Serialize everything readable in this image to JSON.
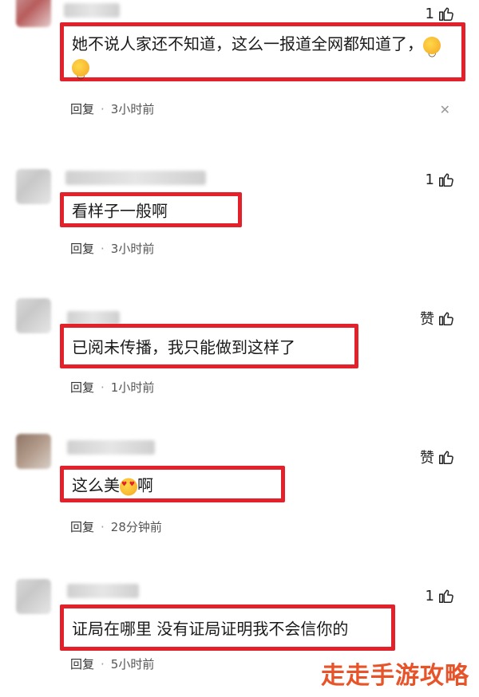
{
  "comments": [
    {
      "text": "她不说人家还不知道，这么一报道全网都知道了，",
      "likes": "1",
      "reply_label": "回复",
      "time": "3小时前",
      "emoji": "laugh-icon"
    },
    {
      "name_partial": "迷迷的救巴巴",
      "text": "看样子一般啊",
      "likes": "1",
      "reply_label": "回复",
      "time": "3小时前"
    },
    {
      "text": "已阅未传播，我只能做到这样了",
      "likes": "赞",
      "reply_label": "回复",
      "time": "1小时前"
    },
    {
      "text_before": "这么美",
      "text_after": "啊",
      "likes": "赞",
      "reply_label": "回复",
      "time": "28分钟前",
      "emoji": "heart-eyes-icon"
    },
    {
      "text": "证局在哪里 没有证局证明我不会信你的",
      "likes": "1",
      "reply_label": "回复",
      "time": "5小时前"
    }
  ],
  "watermark": "走走手游攻略",
  "colors": {
    "highlight": "#e3212b",
    "watermark": "#e8542a"
  }
}
